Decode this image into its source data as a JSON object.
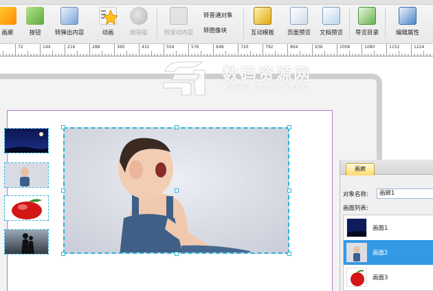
{
  "toolbar": {
    "items": [
      {
        "label": "画廊",
        "icon": "gallery-icon"
      },
      {
        "label": "按钮",
        "icon": "button-hand-icon"
      },
      {
        "label": "转弹出内容",
        "icon": "popup-icon"
      },
      {
        "label": "动画",
        "icon": "animation-star-icon"
      },
      {
        "label": "超链接",
        "icon": "hyperlink-icon"
      },
      {
        "label": "转滚动内容",
        "icon": "scroll-content-icon"
      },
      {
        "label": "转普通对象",
        "icon": ""
      },
      {
        "label": "转图像块",
        "icon": ""
      },
      {
        "label": "互动模板",
        "icon": "interactive-template-icon"
      },
      {
        "label": "页面预览",
        "icon": "page-preview-icon"
      },
      {
        "label": "文档预览",
        "icon": "document-preview-icon"
      },
      {
        "label": "导览目录",
        "icon": "toc-icon"
      },
      {
        "label": "编辑属性",
        "icon": "edit-properties-icon"
      }
    ]
  },
  "ruler": {
    "ticks": [
      "72",
      "144",
      "216",
      "288",
      "360",
      "432",
      "504",
      "576",
      "648",
      "720",
      "792",
      "864",
      "936",
      "1008",
      "1080",
      "1152",
      "1224"
    ]
  },
  "watermark": {
    "text": "数码资源网",
    "url": "www.smzy.com"
  },
  "panel": {
    "tab_label": "画廊",
    "object_name_label": "对象名称:",
    "object_name_value": "画廊1",
    "list_label": "画面列表:",
    "items": [
      {
        "label": "画面1",
        "selected": false,
        "image": "night-sky"
      },
      {
        "label": "画面2",
        "selected": true,
        "image": "baby"
      },
      {
        "label": "画面3",
        "selected": false,
        "image": "apple"
      }
    ]
  },
  "canvas": {
    "thumbnails": [
      "night-sky",
      "baby",
      "apple",
      "couple-silhouette"
    ],
    "main_image": "baby"
  },
  "colors": {
    "selection": "#27b3d9",
    "list_selected": "#3399e6",
    "page_border": "#b07ad0"
  }
}
